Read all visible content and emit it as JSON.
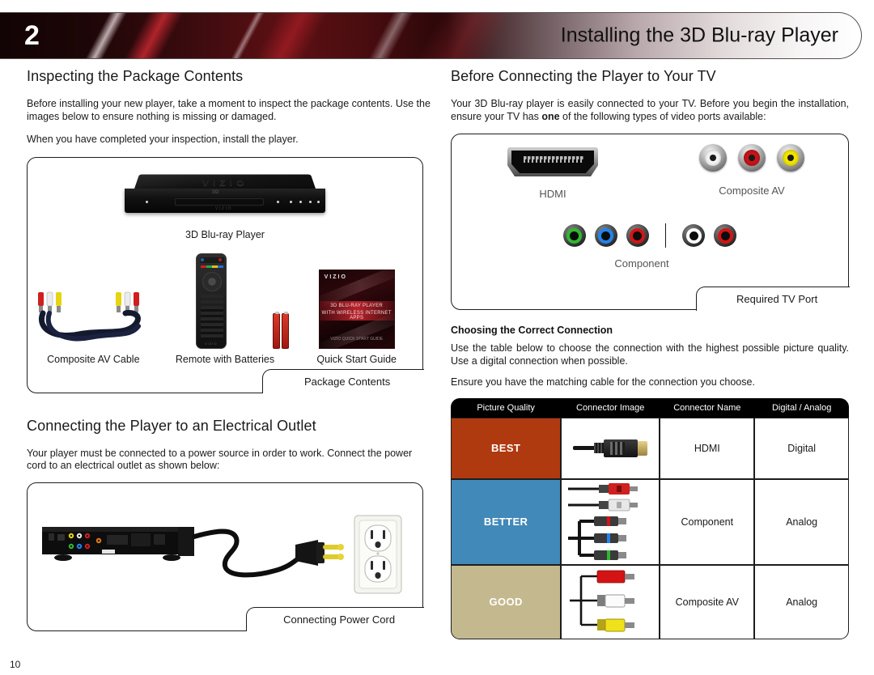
{
  "header": {
    "chapter_number": "2",
    "title": "Installing the 3D Blu-ray Player"
  },
  "page_number": "10",
  "left_column": {
    "section1": {
      "heading": "Inspecting the Package Contents",
      "paragraphs": [
        "Before installing your new player, take a moment to inspect the package contents. Use the images below to ensure nothing is missing or damaged.",
        "When you have completed your inspection, install the player."
      ],
      "figure": {
        "caption": "Package Contents",
        "items": [
          {
            "label": "3D Blu-ray Player",
            "brand": "VIZIO",
            "badge": "3D"
          },
          {
            "label": "Composite AV Cable"
          },
          {
            "label": "Remote with Batteries"
          },
          {
            "label": "Quick Start Guide",
            "cover_brand": "VIZIO",
            "cover_line1": "3D BLU-RAY  PLAYER",
            "cover_line2": "WITH WIRELESS INTERNET APPS",
            "cover_footer": "VIZIO  QUICK START GUIDE"
          }
        ]
      }
    },
    "section2": {
      "heading": "Connecting the Player to an Electrical Outlet",
      "paragraphs": [
        "Your player must be connected to a power source in order to work. Connect the power cord to an electrical outlet as shown below:"
      ],
      "figure": {
        "caption": "Connecting Power Cord"
      }
    }
  },
  "right_column": {
    "section1": {
      "heading": "Before Connecting the Player to Your TV",
      "paragraph_parts": {
        "before": "Your 3D Blu-ray player is easily connected to your TV. Before you begin the installation, ensure your TV has ",
        "bold": "one",
        "after": " of the following types of video ports available:"
      },
      "figure": {
        "caption": "Required TV Port",
        "labels": {
          "hdmi": "HDMI",
          "composite": "Composite AV",
          "component": "Component"
        },
        "composite_jacks": [
          {
            "name": "audio-left-jack",
            "color": "#f2f2f2"
          },
          {
            "name": "audio-right-jack",
            "color": "#c81418"
          },
          {
            "name": "video-jack",
            "color": "#f2e400"
          }
        ],
        "component_jacks": [
          {
            "name": "component-y-jack",
            "color": "#2fb82f"
          },
          {
            "name": "component-pb-jack",
            "color": "#1f84f0"
          },
          {
            "name": "component-pr-jack",
            "color": "#d41414"
          }
        ],
        "component_audio_jacks": [
          {
            "name": "audio-left-jack",
            "color": "#ffffff"
          },
          {
            "name": "audio-right-jack",
            "color": "#d41414"
          }
        ]
      }
    },
    "section2": {
      "subheading": "Choosing the Correct Connection",
      "paragraphs": [
        "Use the table below to choose the connection with the highest possible picture quality. Use a digital connection when possible.",
        "Ensure you have the matching cable for the connection you choose."
      ],
      "table": {
        "columns": [
          "Picture Quality",
          "Connector Image",
          "Connector Name",
          "Digital / Analog"
        ],
        "rows": [
          {
            "quality": "BEST",
            "quality_color": "#b03a10",
            "connector_image": "hdmi-cable-icon",
            "connector_name": "HDMI",
            "signal_type": "Digital"
          },
          {
            "quality": "BETTER",
            "quality_color": "#4189b8",
            "connector_image": "component-cable-icon",
            "connector_name": "Component",
            "signal_type": "Analog"
          },
          {
            "quality": "GOOD",
            "quality_color": "#c4b98e",
            "connector_image": "composite-cable-icon",
            "connector_name": "Composite AV",
            "signal_type": "Analog"
          }
        ]
      }
    }
  }
}
